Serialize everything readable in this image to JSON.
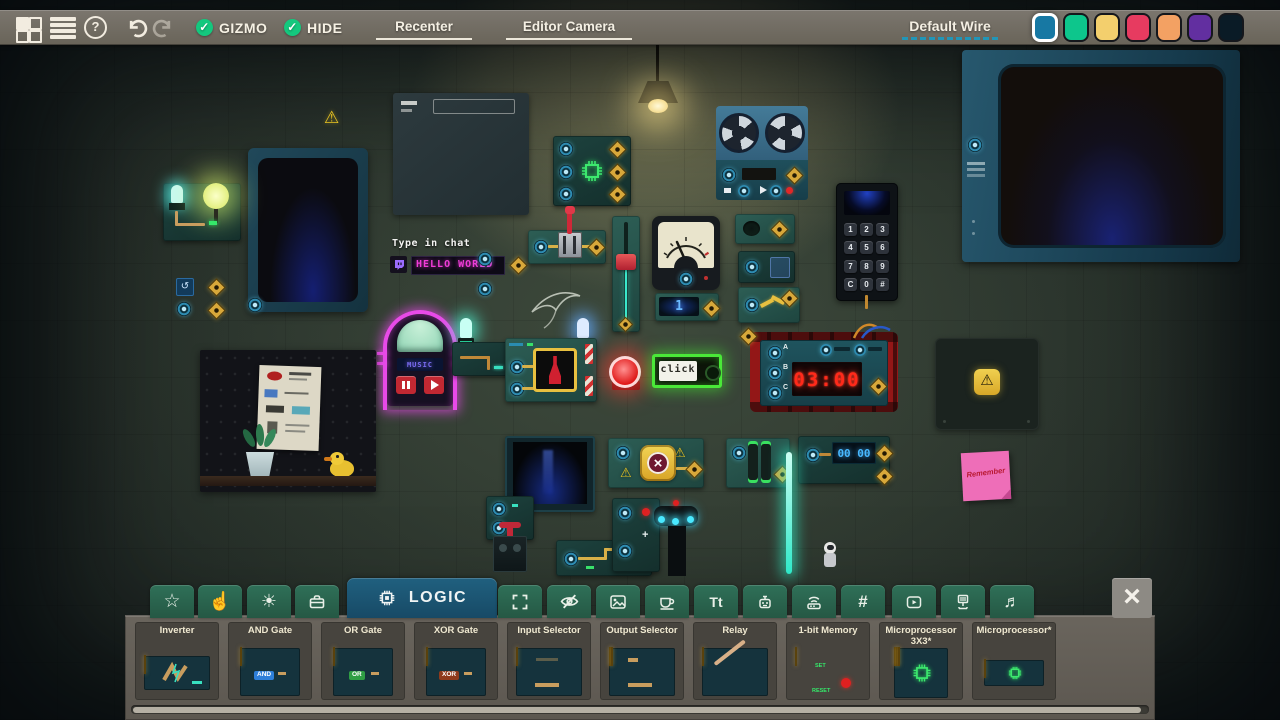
{
  "topbar": {
    "gizmo_label": "GIZMO",
    "hide_label": "HIDE",
    "recenter_label": "Recenter",
    "editor_camera_label": "Editor Camera",
    "default_wire_label": "Default Wire",
    "help_glyph": "?",
    "wire_colors": [
      "#1778a3",
      "#0dc68c",
      "#f3cf6d",
      "#e73b60",
      "#f3a163",
      "#622fa0",
      "#0a1b26"
    ],
    "selected_wire_index": 0
  },
  "scene": {
    "chat_sign": {
      "title": "Type in chat",
      "message": "HELLO WORLD"
    },
    "bomb": {
      "time": "03:00",
      "input_labels": [
        "A",
        "B",
        "C"
      ]
    },
    "click_button_label": "click",
    "jukebox_label": "MUSIC",
    "counter_value": "00 00",
    "number_display_value": "1",
    "sticky_note_text": "Remember",
    "keypad_keys": [
      "1",
      "2",
      "3",
      "4",
      "5",
      "6",
      "7",
      "8",
      "9",
      "C",
      "0",
      "#"
    ]
  },
  "tabbar": {
    "active_tab": {
      "label": "LOGIC",
      "icon": "chip"
    },
    "tab_icons": [
      "star",
      "pointer-hand",
      "sun",
      "toolbox",
      "fullscreen",
      "eye-off",
      "image",
      "coffee",
      "text",
      "robot",
      "antenna",
      "hash",
      "video",
      "network",
      "music"
    ],
    "close_glyph": "×",
    "hash_glyph": "#",
    "text_tab_glyph": "Tt",
    "star_glyph": "☆",
    "hand_glyph": "☝",
    "sun_glyph": "☀",
    "music_glyph": "♬"
  },
  "shelf": {
    "items": [
      {
        "name": "Inverter"
      },
      {
        "name": "AND Gate",
        "badge": "AND",
        "badge_color": "#2e7fd9"
      },
      {
        "name": "OR Gate",
        "badge": "OR",
        "badge_color": "#2f9e44"
      },
      {
        "name": "XOR Gate",
        "badge": "XOR",
        "badge_color": "#8f3a1c"
      },
      {
        "name": "Input Selector"
      },
      {
        "name": "Output Selector"
      },
      {
        "name": "Relay"
      },
      {
        "name": "1-bit Memory",
        "set_label": "SET",
        "reset_label": "RESET"
      },
      {
        "name": "Microprocessor 3X3*"
      },
      {
        "name": "Microprocessor*"
      }
    ]
  }
}
